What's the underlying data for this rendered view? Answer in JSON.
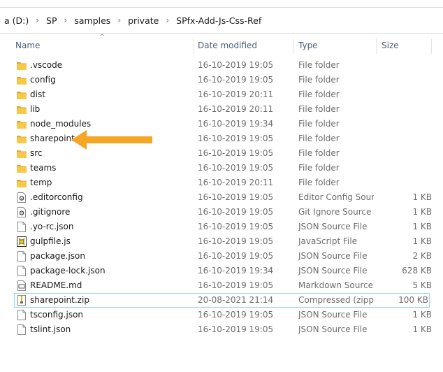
{
  "breadcrumb": [
    "a (D:)",
    "SP",
    "samples",
    "private",
    "SPfx-Add-Js-Css-Ref"
  ],
  "columns": {
    "name": "Name",
    "date": "Date modified",
    "type": "Type",
    "size": "Size"
  },
  "colors": {
    "folder": "#f7c94b",
    "folder_dark": "#e2a931",
    "arrow": "#f5a623",
    "selection_border": "#99d1ff"
  },
  "files": [
    {
      "name": ".vscode",
      "date": "16-10-2019 19:05",
      "type": "File folder",
      "size": "",
      "icon": "folder-icon"
    },
    {
      "name": "config",
      "date": "16-10-2019 19:05",
      "type": "File folder",
      "size": "",
      "icon": "folder-icon"
    },
    {
      "name": "dist",
      "date": "16-10-2019 20:11",
      "type": "File folder",
      "size": "",
      "icon": "folder-icon"
    },
    {
      "name": "lib",
      "date": "16-10-2019 20:11",
      "type": "File folder",
      "size": "",
      "icon": "folder-icon"
    },
    {
      "name": "node_modules",
      "date": "16-10-2019 19:34",
      "type": "File folder",
      "size": "",
      "icon": "folder-icon"
    },
    {
      "name": "sharepoint",
      "date": "16-10-2019 19:05",
      "type": "File folder",
      "size": "",
      "icon": "folder-icon"
    },
    {
      "name": "src",
      "date": "16-10-2019 19:05",
      "type": "File folder",
      "size": "",
      "icon": "folder-icon"
    },
    {
      "name": "teams",
      "date": "16-10-2019 19:05",
      "type": "File folder",
      "size": "",
      "icon": "folder-icon"
    },
    {
      "name": "temp",
      "date": "16-10-2019 20:11",
      "type": "File folder",
      "size": "",
      "icon": "folder-icon"
    },
    {
      "name": ".editorconfig",
      "date": "16-10-2019 19:05",
      "type": "Editor Config Sour...",
      "size": "1 KB",
      "icon": "config-file-icon"
    },
    {
      "name": ".gitignore",
      "date": "16-10-2019 19:05",
      "type": "Git Ignore Source ...",
      "size": "1 KB",
      "icon": "config-file-icon"
    },
    {
      "name": ".yo-rc.json",
      "date": "16-10-2019 19:05",
      "type": "JSON Source File",
      "size": "1 KB",
      "icon": "document-icon"
    },
    {
      "name": "gulpfile.js",
      "date": "16-10-2019 19:05",
      "type": "JavaScript File",
      "size": "1 KB",
      "icon": "script-file-icon"
    },
    {
      "name": "package.json",
      "date": "16-10-2019 19:05",
      "type": "JSON Source File",
      "size": "2 KB",
      "icon": "document-icon"
    },
    {
      "name": "package-lock.json",
      "date": "16-10-2019 19:34",
      "type": "JSON Source File",
      "size": "628 KB",
      "icon": "document-icon"
    },
    {
      "name": "README.md",
      "date": "16-10-2019 19:05",
      "type": "Markdown Source...",
      "size": "5 KB",
      "icon": "markdown-file-icon"
    },
    {
      "name": "sharepoint.zip",
      "date": "20-08-2021 21:14",
      "type": "Compressed (zipp...",
      "size": "100 KB",
      "icon": "zip-file-icon",
      "selected": true
    },
    {
      "name": "tsconfig.json",
      "date": "16-10-2019 19:05",
      "type": "JSON Source File",
      "size": "1 KB",
      "icon": "document-icon"
    },
    {
      "name": "tslint.json",
      "date": "16-10-2019 19:05",
      "type": "JSON Source File",
      "size": "1 KB",
      "icon": "document-icon"
    }
  ]
}
